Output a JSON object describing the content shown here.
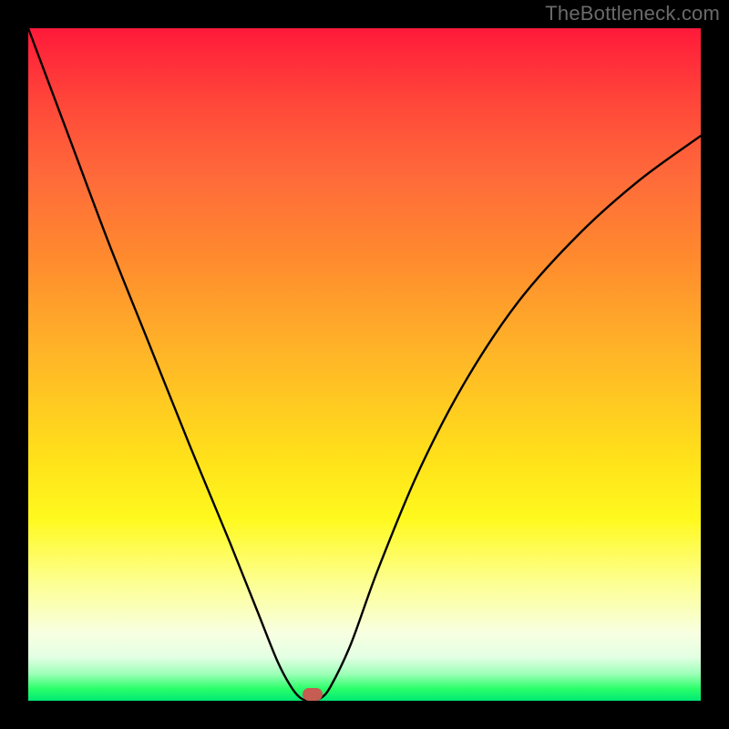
{
  "watermark": "TheBottleneck.com",
  "chart_data": {
    "type": "line",
    "title": "",
    "xlabel": "",
    "ylabel": "",
    "xlim": [
      0,
      100
    ],
    "ylim": [
      0,
      100
    ],
    "background_gradient": {
      "direction": "top-to-bottom",
      "stops": [
        {
          "pos": 0,
          "color": "#ff1a3a"
        },
        {
          "pos": 64,
          "color": "#ffe11a"
        },
        {
          "pos": 90,
          "color": "#f8ffe2"
        },
        {
          "pos": 100,
          "color": "#00e874"
        }
      ]
    },
    "series": [
      {
        "name": "bottleneck-curve",
        "color": "#000000",
        "points": [
          {
            "x": 0.0,
            "y": 100.0
          },
          {
            "x": 6.0,
            "y": 84.0
          },
          {
            "x": 12.0,
            "y": 68.0
          },
          {
            "x": 18.0,
            "y": 53.0
          },
          {
            "x": 24.0,
            "y": 38.0
          },
          {
            "x": 30.0,
            "y": 23.5
          },
          {
            "x": 34.0,
            "y": 13.5
          },
          {
            "x": 37.0,
            "y": 6.0
          },
          {
            "x": 39.0,
            "y": 2.2
          },
          {
            "x": 40.5,
            "y": 0.4
          },
          {
            "x": 42.0,
            "y": 0.0
          },
          {
            "x": 43.5,
            "y": 0.4
          },
          {
            "x": 45.0,
            "y": 2.2
          },
          {
            "x": 48.0,
            "y": 8.5
          },
          {
            "x": 52.0,
            "y": 19.5
          },
          {
            "x": 58.0,
            "y": 34.0
          },
          {
            "x": 65.0,
            "y": 47.5
          },
          {
            "x": 73.0,
            "y": 59.5
          },
          {
            "x": 82.0,
            "y": 69.5
          },
          {
            "x": 91.0,
            "y": 77.5
          },
          {
            "x": 100.0,
            "y": 84.0
          }
        ]
      }
    ],
    "marker": {
      "x": 42.3,
      "y": 1.0,
      "color": "#c65d52"
    }
  },
  "plot": {
    "inner_left": 31,
    "inner_top": 31,
    "inner_width": 738,
    "inner_height": 738
  }
}
